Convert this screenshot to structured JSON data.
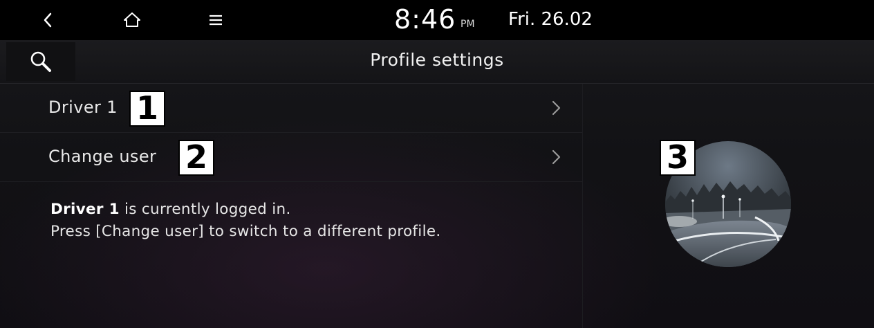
{
  "status_bar": {
    "back_icon": "chevron-left-icon",
    "home_icon": "home-icon",
    "menu_icon": "hamburger-menu-icon",
    "time": "8:46",
    "ampm": "PM",
    "date": "Fri. 26.02"
  },
  "header": {
    "search_icon": "search-icon",
    "title": "Profile settings"
  },
  "list": {
    "items": [
      {
        "label": "Driver 1",
        "callout": "1",
        "icon": "chevron-right-icon"
      },
      {
        "label": "Change user",
        "callout": "2",
        "icon": "chevron-right-icon"
      }
    ]
  },
  "info": {
    "user": "Driver 1",
    "line1_rest": " is currently logged in.",
    "line2": "Press [Change user] to switch to a different profile."
  },
  "profile_image": {
    "callout": "3"
  },
  "colors": {
    "background": "#000000",
    "panel": "#141417",
    "text": "#e9e9e9",
    "chevron": "#9a9a9a"
  }
}
